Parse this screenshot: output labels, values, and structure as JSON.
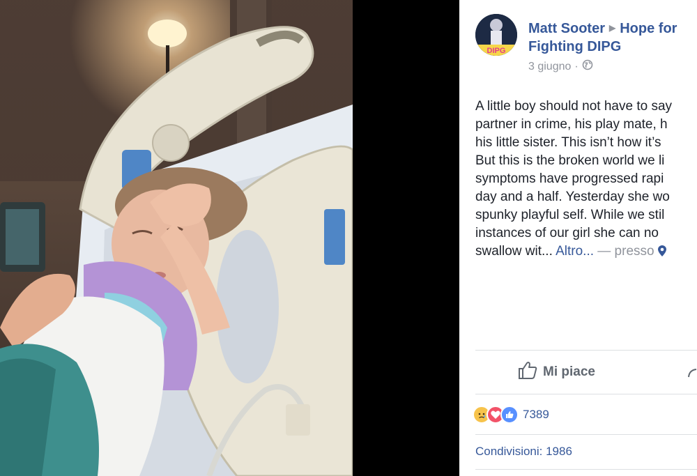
{
  "post": {
    "author": "Matt Sooter",
    "group_line1": "Hope for",
    "group_line2": "Fighting DIPG",
    "date": "3 giugno",
    "dot": "·",
    "text_lines": [
      "A little boy should not have to say",
      "partner in crime, his play mate, h",
      "his little sister. This isn’t how it’s",
      "But this is the broken world we li",
      "symptoms have progressed rapi",
      "day and a half. Yesterday she wo",
      "spunky playful self. While we stil",
      "instances of our girl she can no"
    ],
    "last_line_text": "swallow wit...",
    "more_link": "Altro...",
    "location_prefix": "— presso",
    "avatar_label": "DIPG"
  },
  "actions": {
    "like_label": "Mi piace"
  },
  "stats": {
    "reaction_count": "7389",
    "shares": "Condivisioni: 1986"
  },
  "colors": {
    "link": "#365899",
    "meta": "#90949c",
    "text": "#1d2129",
    "love": "#f25268",
    "like": "#5890ff",
    "sad": "#f7c34b"
  },
  "icons": {
    "like": "thumbs-up-icon",
    "share": "share-arrow-icon",
    "globe": "globe-icon",
    "location": "location-pin-icon",
    "group_arrow": "triangle-right-icon"
  }
}
